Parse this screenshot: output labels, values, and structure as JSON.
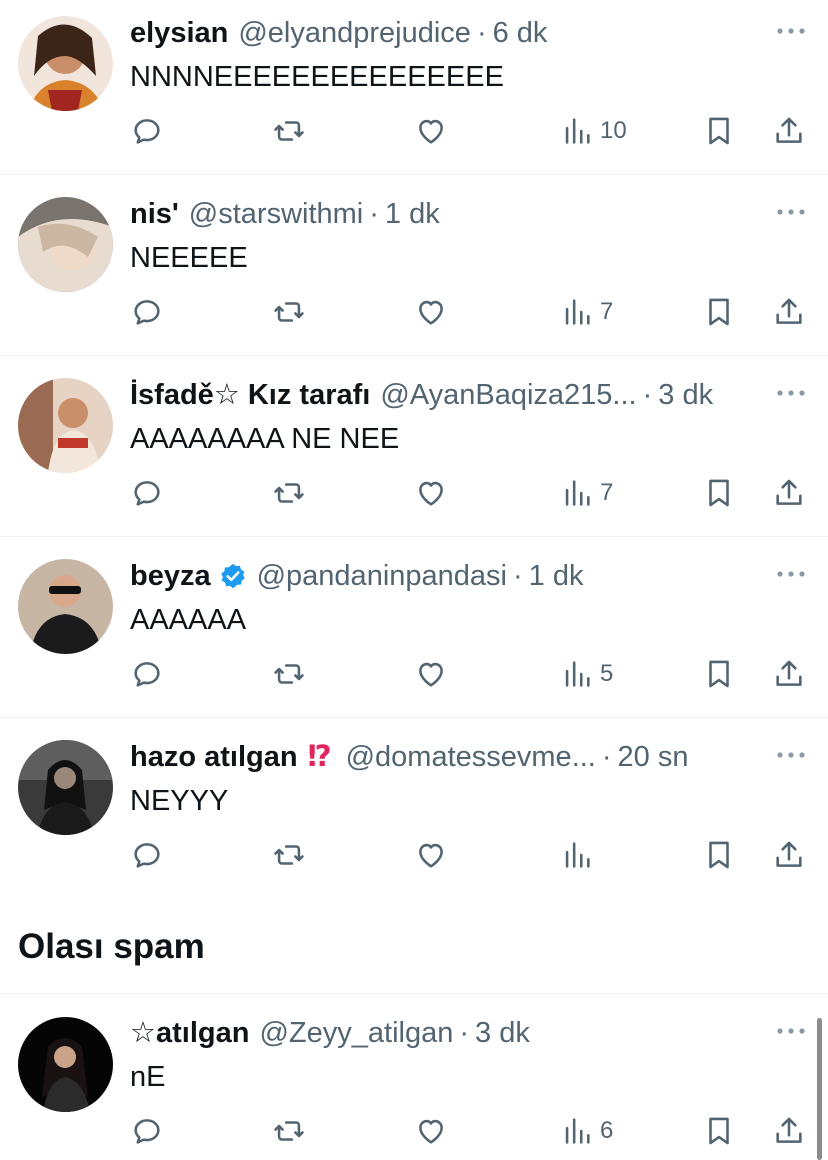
{
  "tweets": [
    {
      "name": "elysian",
      "handle": "@elyandprejudice",
      "separator": "·",
      "time": "6 dk",
      "text": "NNNNEEEEEEEEEEEEEEE",
      "views": "10",
      "avatar_colors": [
        "#5b3a2a",
        "#c47a3a",
        "#e09a30"
      ]
    },
    {
      "name": "nis'",
      "handle": "@starswithmi",
      "separator": "·",
      "time": "1 dk",
      "text": "NEEEEE",
      "views": "7",
      "avatar_colors": [
        "#8b8680",
        "#e2d4c7",
        "#c9b8a8"
      ]
    },
    {
      "name": "İsfadě☆ Kız tarafı",
      "handle": "@AyanBaqiza215...",
      "separator": "·",
      "time": "3 dk",
      "text": "AAAAAAAA NE NEE",
      "views": "7",
      "avatar_colors": [
        "#c9a48a",
        "#e8cfc0",
        "#9a6b52"
      ]
    },
    {
      "name": "beyza",
      "handle": "@pandaninpandasi",
      "separator": "·",
      "time": "1 dk",
      "text": "AAAAAA",
      "views": "5",
      "verified": true,
      "avatar_colors": [
        "#b8a898",
        "#d9cbbd",
        "#1b1b1b"
      ]
    },
    {
      "name": "hazo atılgan",
      "emoji": "⁉",
      "handle": "@domatessevme...",
      "separator": "·",
      "time": "20 sn",
      "text": "NEYYY",
      "views": "",
      "avatar_colors": [
        "#2a2a2a",
        "#6b6b6b",
        "#111111"
      ]
    },
    {
      "name": "☆atılgan",
      "handle": "@Zeyy_atilgan",
      "separator": "·",
      "time": "3 dk",
      "text": "nE",
      "views": "6",
      "avatar_colors": [
        "#050505",
        "#3a2a2a",
        "#c9a48a"
      ]
    }
  ],
  "section": {
    "title": "Olası spam"
  },
  "icons": {
    "reply": "reply-icon",
    "retweet": "retweet-icon",
    "like": "heart-icon",
    "views": "views-icon",
    "bookmark": "bookmark-icon",
    "share": "share-icon",
    "more": "more-icon",
    "verified": "verified-badge-icon"
  },
  "colors": {
    "text": "#0f1419",
    "secondary": "#536471",
    "verified_blue": "#1d9bf0",
    "divider": "#eff3f4"
  }
}
